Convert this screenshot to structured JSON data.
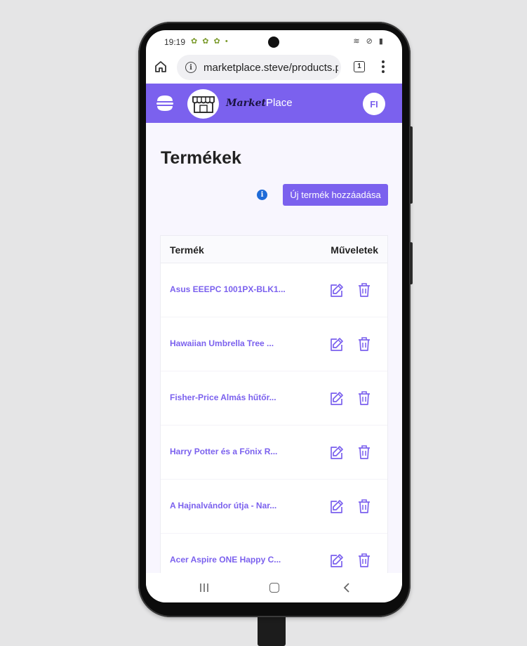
{
  "status_bar": {
    "time": "19:19",
    "left_icons": "✿ ✿ ✿ •",
    "right_icons": "≋ ⊘ ▮"
  },
  "browser": {
    "url": "marketplace.steve/products.p",
    "tab_count": "1"
  },
  "app_header": {
    "logo_bold": "Market",
    "logo_regular": "Place",
    "avatar_initials": "FI",
    "brand_color": "#7b61ee"
  },
  "page": {
    "title": "Termékek",
    "add_button_label": "Új termék hozzáadása"
  },
  "table": {
    "headers": {
      "product": "Termék",
      "actions": "Műveletek"
    },
    "rows": [
      {
        "name": "Asus EEEPC 1001PX-BLK1..."
      },
      {
        "name": "Hawaiian Umbrella Tree ..."
      },
      {
        "name": "Fisher-Price Almás hűtőr..."
      },
      {
        "name": "Harry Potter és a Főnix R..."
      },
      {
        "name": "A Hajnalvándor útja - Nar..."
      },
      {
        "name": "Acer Aspire ONE Happy C..."
      }
    ]
  },
  "icons": {
    "home": "home-icon",
    "info": "info-icon",
    "tabs": "tabs-icon",
    "menu": "more-vertical-icon",
    "hamburger": "hamburger-icon",
    "logo": "market-stall-icon",
    "help": "info-circle-icon",
    "edit": "edit-icon",
    "delete": "trash-icon",
    "nav_recent": "recent-apps-icon",
    "nav_home": "nav-home-icon",
    "nav_back": "back-icon"
  }
}
